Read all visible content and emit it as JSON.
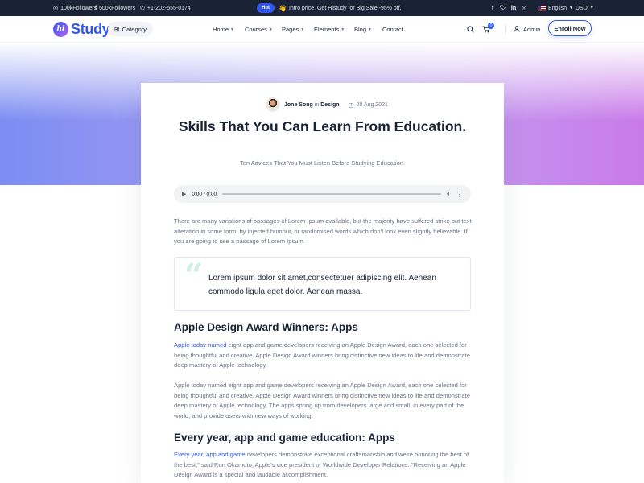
{
  "topbar": {
    "followers_1": "100kFollowers",
    "followers_2": "500kFollowers",
    "phone": "+1-202-555-0174",
    "hot_badge": "Hot",
    "promo_emoji": "👋",
    "promo_text": "Intro price. Get Histudy for Big Sale -95% off.",
    "language": "English",
    "currency": "USD",
    "social_icons": [
      "facebook-icon",
      "twitter-icon",
      "linkedin-icon",
      "instagram-icon"
    ]
  },
  "header": {
    "logo_mark": "hi",
    "logo_text": "Study",
    "category_label": "Category",
    "nav": [
      "Home",
      "Courses",
      "Pages",
      "Elements",
      "Blog",
      "Contact"
    ],
    "cart_count": "0",
    "admin_label": "Admin",
    "enroll_label": "Enroll Now"
  },
  "article": {
    "author": "Jone Song",
    "in_word": "in",
    "category": "Design",
    "date": "20 Aug 2021",
    "title": "Skills That You Can Learn From Education.",
    "subtitle": "Ten Advices That You Must Listen Before Studying Education.",
    "audio_time": "0:00 / 0:00",
    "intro": "There are many variations of passages of Lorem Ipsum available, but the majority have suffered strike out text alteration in some form, by injected humour, or randomised words which don't look even slightly believable. If you are going to use a passage of Lorem Ipsum.",
    "quote": "Lorem ipsum dolor sit amet,consectetuer adipiscing elit. Aenean commodo ligula eget dolor. Aenean massa.",
    "heading_1": "Apple Design Award Winners: Apps",
    "p1_link": "Apple today named",
    "p1_rest": " eight app and game developers receiving an Apple Design Award, each one selected for being thoughtful and creative. Apple Design Award winners bring distinctive new ideas to life and demonstrate deep mastery of Apple technology.",
    "p2": "Apple today named eight app and game developers receiving an Apple Design Award, each one selected for being thoughtful and creative. Apple Design Award winners bring distinctive new ideas to life and demonstrate deep mastery of Apple technology. The apps spring up from developers large and small, in every part of the world, and provide users with new ways of working.",
    "heading_2": "Every year, app and game education: Apps",
    "p3_link": "Every year, app and game",
    "p3_rest": " developers demonstrate exceptional craftsmanship and we're honoring the best of the best,\" said Ron Okamoto, Apple's vice president of Worldwide Developer Relations. \"Receiving an Apple Design Award is a special and laudable accomplishment."
  },
  "colors": {
    "primary": "#2f57ef",
    "heading": "#192335",
    "body_text": "#6b7385",
    "topbar_bg": "#192335"
  }
}
